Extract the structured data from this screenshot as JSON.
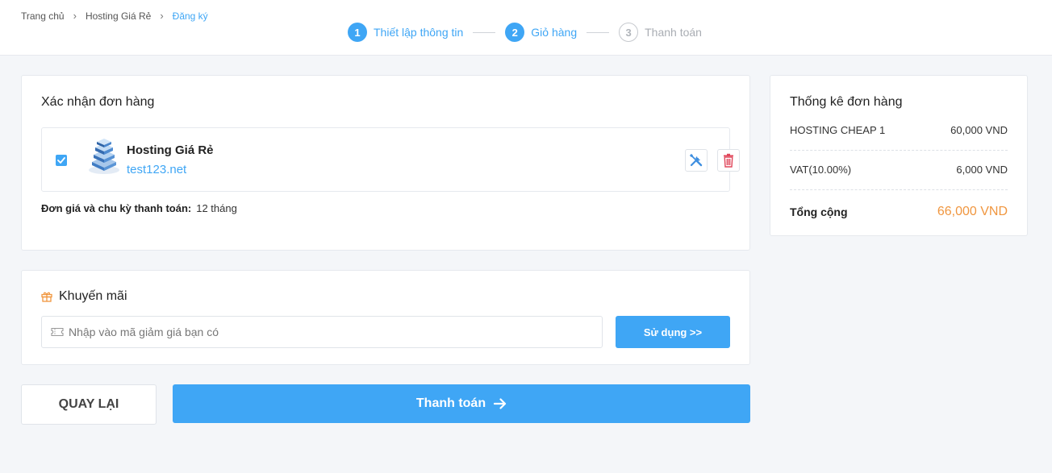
{
  "breadcrumb": {
    "home": "Trang chủ",
    "product": "Hosting Giá Rẻ",
    "current": "Đăng ký"
  },
  "steps": [
    {
      "num": "1",
      "label": "Thiết lập thông tin",
      "state": "active"
    },
    {
      "num": "2",
      "label": "Giỏ hàng",
      "state": "active"
    },
    {
      "num": "3",
      "label": "Thanh toán",
      "state": "inactive"
    }
  ],
  "confirm": {
    "title": "Xác nhận đơn hàng",
    "item": {
      "name": "Hosting Giá Rẻ",
      "domain": "test123.net",
      "checked": true
    },
    "cycle_label": "Đơn giá và chu kỳ thanh toán:",
    "cycle_value": "12 tháng"
  },
  "promo": {
    "title": "Khuyến mãi",
    "placeholder": "Nhập vào mã giảm giá bạn có",
    "value": "",
    "use_label": "Sử dụng >>"
  },
  "actions": {
    "back_label": "QUAY LẠI",
    "pay_label": "Thanh toán"
  },
  "summary": {
    "title": "Thống kê đơn hàng",
    "rows": [
      {
        "label": "HOSTING CHEAP 1",
        "value": "60,000 VND"
      },
      {
        "label": "VAT(10.00%)",
        "value": "6,000 VND"
      }
    ],
    "total_label": "Tổng cộng",
    "total_value": "66,000 VND"
  },
  "colors": {
    "accent": "#3fa6f5",
    "total": "#f0963f",
    "delete": "#e0465a",
    "background": "#f4f6f9"
  },
  "icons": {
    "item": "server-stack-icon",
    "tools": "tools-icon",
    "delete": "trash-icon",
    "promo": "gift-icon",
    "coupon": "ticket-icon",
    "pay": "arrow-right-icon"
  }
}
